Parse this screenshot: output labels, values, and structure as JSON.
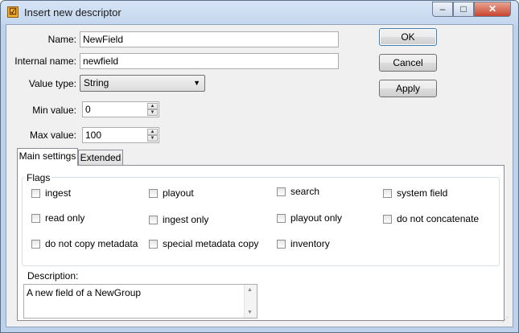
{
  "window": {
    "title": "Insert new descriptor",
    "app_icon": "descriptor-app-icon",
    "controls": {
      "minimize": "–",
      "maximize": "□",
      "close": "✕"
    }
  },
  "form": {
    "name_label": "Name:",
    "name_value": "NewField",
    "internal_name_label": "Internal name:",
    "internal_name_value": "newfield",
    "value_type_label": "Value type:",
    "value_type_selected": "String",
    "min_label": "Min value:",
    "min_value": "0",
    "max_label": "Max value:",
    "max_value": "100"
  },
  "buttons": {
    "ok": "OK",
    "cancel": "Cancel",
    "apply": "Apply"
  },
  "tabs": [
    {
      "label": "Main settings",
      "active": true
    },
    {
      "label": "Extended",
      "active": false
    }
  ],
  "flags": {
    "title": "Flags",
    "items": [
      {
        "label": "ingest",
        "checked": false
      },
      {
        "label": "playout",
        "checked": false
      },
      {
        "label": "search",
        "checked": false
      },
      {
        "label": "system field",
        "checked": false
      },
      {
        "label": "read only",
        "checked": false
      },
      {
        "label": "ingest only",
        "checked": false
      },
      {
        "label": "playout only",
        "checked": false
      },
      {
        "label": "do not concatenate",
        "checked": false
      },
      {
        "label": "do not copy metadata",
        "checked": false
      },
      {
        "label": "special metadata copy",
        "checked": false
      },
      {
        "label": "inventory",
        "checked": false
      }
    ]
  },
  "description": {
    "label": "Description:",
    "value": "A new field of a NewGroup"
  }
}
